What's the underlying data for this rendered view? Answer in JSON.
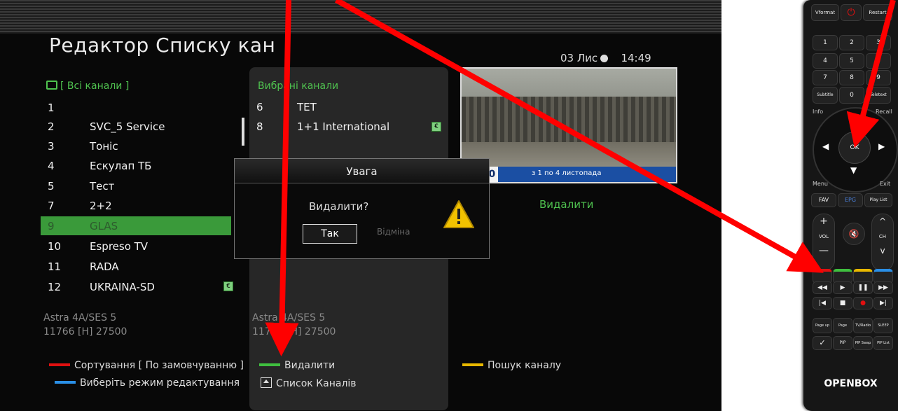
{
  "screen": {
    "title": "Редактор Списку кан",
    "date": "03 Лис",
    "time": "14:49"
  },
  "left_list": {
    "header": "[ Всі канали ]",
    "rows": [
      {
        "num": "1",
        "name": "",
        "selected": false
      },
      {
        "num": "2",
        "name": "SVC_5 Service",
        "selected": false
      },
      {
        "num": "3",
        "name": "Тоніс",
        "selected": false
      },
      {
        "num": "4",
        "name": "Ескулап ТБ",
        "selected": false
      },
      {
        "num": "5",
        "name": "Тест",
        "selected": false
      },
      {
        "num": "7",
        "name": "2+2",
        "selected": false
      },
      {
        "num": "9",
        "name": "GLAS",
        "selected": true
      },
      {
        "num": "10",
        "name": "Espreso TV",
        "selected": false
      },
      {
        "num": "11",
        "name": "RADA",
        "selected": false
      },
      {
        "num": "12",
        "name": "UKRAINA-SD",
        "selected": false
      }
    ],
    "sat_name": "Astra 4A/SES 5",
    "sat_freq": "11766 [H] 27500"
  },
  "mid_list": {
    "header": "Вибрані канали",
    "rows": [
      {
        "num": "6",
        "name": "ТЕТ"
      },
      {
        "num": "8",
        "name": "1+1 International"
      }
    ],
    "sat_name": "Astra 4A/SES 5",
    "sat_freq": "11766 [H] 27500"
  },
  "preview": {
    "ticker_time": "14:00",
    "ticker_text": "з 1 по 4 листопада",
    "action_label": "Видалити"
  },
  "dialog": {
    "title": "Увага",
    "question": "Видалити?",
    "yes_label": "Так",
    "no_label": "Відміна"
  },
  "legend": {
    "red_label": "Сортування [ По замовчуванню ]",
    "green_label": "Видалити",
    "yellow_label": "Пошук каналу",
    "blue_label": "Виберіть режим редактування",
    "list_label": "Список Каналів"
  },
  "remote": {
    "brand": "OPENBOX",
    "top_left": "Vformat",
    "top_right": "Restart",
    "digits": [
      "1",
      "2",
      "3",
      "4",
      "5",
      "6",
      "7",
      "8",
      "9",
      "0"
    ],
    "subtitle": "Subtitle",
    "teletext": "Teletext",
    "info": "Info",
    "recall": "Recall",
    "menu": "Menu",
    "exit": "Exit",
    "ok": "OK",
    "fav": "FAV",
    "epg": "EPG",
    "play_list": "Play List",
    "vol": "VOL",
    "ch": "CH",
    "page_up": "Page up",
    "page_down": "Page down",
    "tv_radio": "TV/Radio",
    "sleep": "SLEEP",
    "pip": "PIP",
    "pip_swap": "PIP Swap",
    "pip_list": "PIP List"
  },
  "colors": {
    "accent_green": "#4fc24f",
    "red": "#e01010",
    "yellow": "#e8b800",
    "blue": "#2a8fe6",
    "arrow": "#ff0000"
  }
}
